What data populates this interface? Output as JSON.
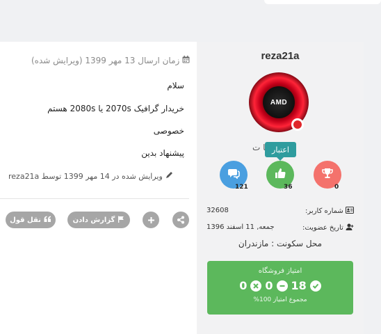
{
  "author": {
    "name": "reza21a"
  },
  "role_text": "کا   ت",
  "tooltip_text": "اعتبار",
  "stats": {
    "posts": {
      "count": "121",
      "icon": "comments-icon",
      "color": "#4a9fe0"
    },
    "reputation": {
      "count": "36",
      "icon": "thumbs-up-icon",
      "color": "#5cb85c"
    },
    "awards": {
      "count": "0",
      "icon": "trophy-icon",
      "color": "#f4726c"
    }
  },
  "info": {
    "user_number_label": "شماره کاربر:",
    "user_number_value": "32608",
    "join_label": "تاریخ عضویت:",
    "join_value": "جمعه, 11 اسفند 1396"
  },
  "location": "محل سکونت : مازندران",
  "store_score": {
    "title": "امتیاز فروشگاه",
    "positive": "18",
    "neutral": "0",
    "negative": "0",
    "total_label": "مجموع امتیاز 100%"
  },
  "post": {
    "meta": "زمان ارسال 13 مهر 1399 (ویرایش شده)",
    "lines": [
      "سلام",
      "خریدار گرافیک 2070s یا 2080s هستم",
      "خصوصی",
      "پیشنهاد بدین"
    ],
    "edited": "ویرایش شده در 14 مهر 1399 توسط reza21a"
  },
  "actions": {
    "report": "گزارش دادن",
    "quote": "نقل قول"
  },
  "colors": {
    "green": "#5cb85c",
    "grey_button": "#a6a6a6",
    "tooltip": "#2f9c9e"
  }
}
